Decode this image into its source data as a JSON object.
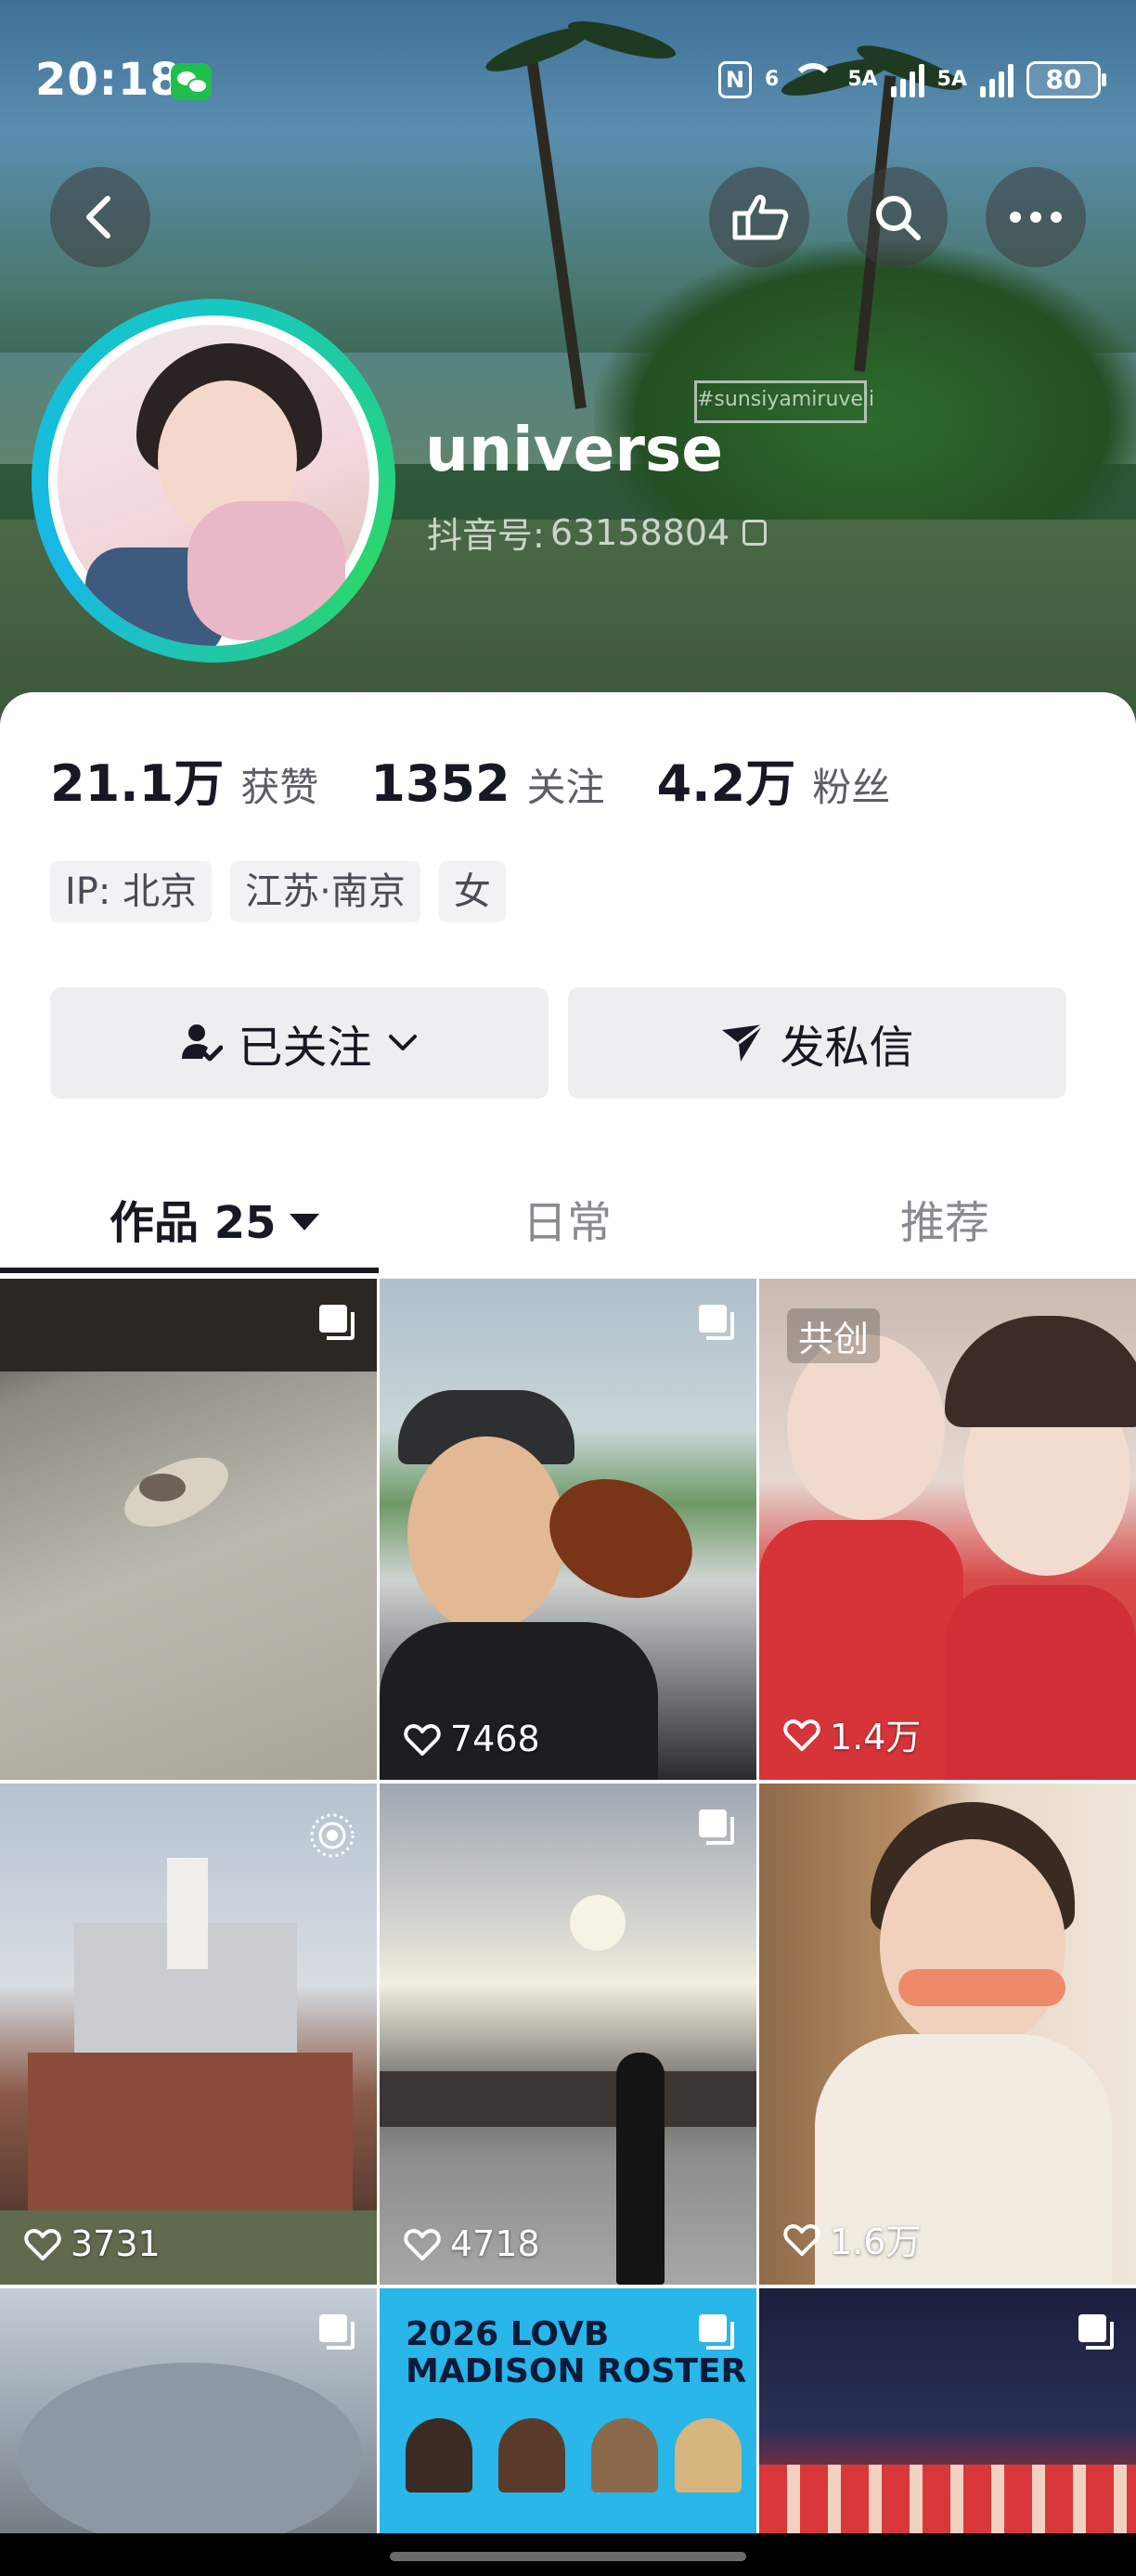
{
  "status_bar": {
    "time": "20:18",
    "nfc": "N",
    "signal1": "6",
    "signal2": "5A",
    "signal3": "5A",
    "battery": "80"
  },
  "profile": {
    "name": "universe",
    "douyin_id_label": "抖音号:",
    "douyin_id": "63158804"
  },
  "stats": [
    {
      "value": "21.1万",
      "label": "获赞"
    },
    {
      "value": "1352",
      "label": "关注"
    },
    {
      "value": "4.2万",
      "label": "粉丝"
    }
  ],
  "tags": [
    "IP:  北京",
    "江苏·南京",
    "女"
  ],
  "actions": {
    "follow": "已关注",
    "message": "发私信"
  },
  "tabs": {
    "works": "作品 25",
    "daily": "日常",
    "recommend": "推荐"
  },
  "grid": {
    "badge_cocreate": "共创",
    "likes": [
      "7468",
      "1.4万",
      "3731",
      "4718",
      "1.6万"
    ],
    "roster_title_1": "2026 LOVB",
    "roster_title_2": "MADISON ROSTER"
  },
  "colors": {
    "accent_ring_start": "#16c7c4",
    "accent_ring_end": "#2bd66b",
    "text_primary": "#161823",
    "text_secondary": "#5c5e66"
  }
}
